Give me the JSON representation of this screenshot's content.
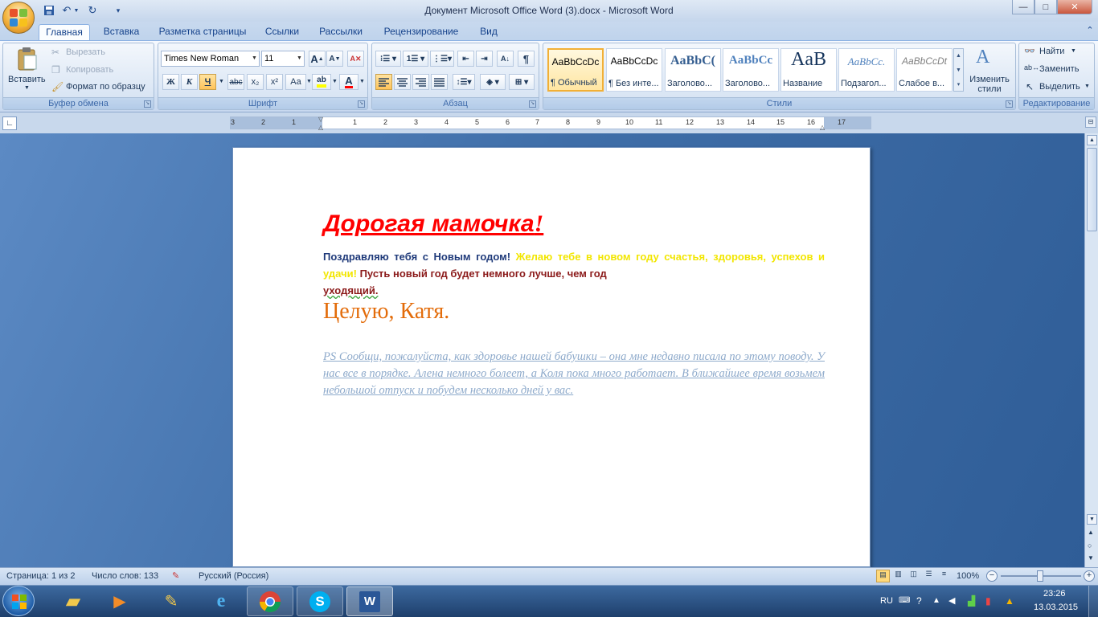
{
  "window": {
    "title": "Документ Microsoft Office Word (3).docx - Microsoft Word",
    "controls": [
      "—",
      "□",
      "✕"
    ]
  },
  "qat": {
    "icons": [
      "save-icon",
      "undo-icon",
      "redo-icon",
      "customize-icon"
    ]
  },
  "tabs": [
    "Главная",
    "Вставка",
    "Разметка страницы",
    "Ссылки",
    "Рассылки",
    "Рецензирование",
    "Вид"
  ],
  "clipboard": {
    "paste": "Вставить",
    "cut": "Вырезать",
    "copy": "Копировать",
    "format_painter": "Формат по образцу",
    "label": "Буфер обмена"
  },
  "font": {
    "name": "Times New Roman",
    "size": "11",
    "label": "Шрифт",
    "bold": "Ж",
    "italic": "К",
    "underline": "Ч",
    "strike": "abc",
    "sub": "x₂",
    "sup": "x²",
    "case": "Aa",
    "grow": "A",
    "shrink": "A",
    "color_letter": "A"
  },
  "paragraph": {
    "label": "Абзац",
    "pilcrow": "¶"
  },
  "styles": {
    "label": "Стили",
    "items": [
      {
        "sample": "AaBbCcDc",
        "name": "¶ Обычный"
      },
      {
        "sample": "AaBbCcDc",
        "name": "¶ Без инте..."
      },
      {
        "sample": "AaBbC(",
        "name": "Заголово..."
      },
      {
        "sample": "AaBbCc",
        "name": "Заголово..."
      },
      {
        "sample": "AaB",
        "name": "Название"
      },
      {
        "sample": "AaBbCc.",
        "name": "Подзагол..."
      },
      {
        "sample": "AaBbCcDt",
        "name": "Слабое в..."
      }
    ],
    "change": "Изменить стили"
  },
  "editing": {
    "find": "Найти",
    "replace": "Заменить",
    "select": "Выделить",
    "label": "Редактирование"
  },
  "ruler": {
    "ticks": [
      "3",
      "2",
      "1",
      "1",
      "2",
      "3",
      "4",
      "5",
      "6",
      "7",
      "8",
      "9",
      "10",
      "11",
      "12",
      "13",
      "14",
      "15",
      "16",
      "17"
    ]
  },
  "document": {
    "heading": "Дорогая мамочка",
    "heading_mark": "!",
    "p1_a": "Поздравляю тебя с Новым годом!",
    "p1_b": "Желаю тебе в новом году счастья, здоровья, успехов и удачи!",
    "p1_c": "Пусть новый год будет немного лучше, чем год",
    "p1_d": "уходящий.",
    "signature": "Целую, Катя.",
    "ps": "PS Сообщи, пожалуйста, как здоровье нашей бабушки – она мне недавно писала по этому поводу. У нас все в порядке. Алена немного болеет, а Коля пока много работает. В ближайшее время возьмем небольшой отпуск и побудем несколько дней у вас."
  },
  "status": {
    "page": "Страница: 1 из 2",
    "words": "Число слов: 133",
    "language": "Русский (Россия)",
    "zoom": "100%"
  },
  "taskbar": {
    "lang": "RU",
    "time": "23:26",
    "date": "13.03.2015"
  },
  "colors": {
    "heading": "#ff0000",
    "blue_text": "#1f3a7a",
    "yellow_text": "#f2e600",
    "dark_red": "#8b1a1a",
    "signature": "#e36c0a",
    "ps": "#8eaacb"
  }
}
